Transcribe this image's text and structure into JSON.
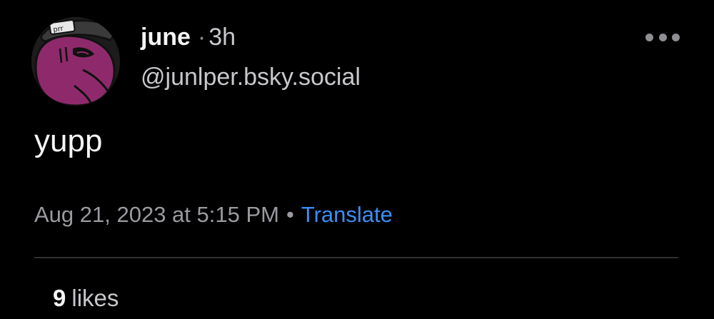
{
  "author": {
    "display_name": "june",
    "separator": "·",
    "age": "3h",
    "handle": "@junlper.bsky.social",
    "avatar_icon": "purple-character-avatar-icon",
    "avatar_hat_text": "prr"
  },
  "post": {
    "text": "yupp"
  },
  "meta": {
    "timestamp": "Aug 21, 2023 at 5:15 PM",
    "dot": "•",
    "translate_label": "Translate"
  },
  "stats": {
    "likes_count": "9",
    "likes_label": "likes"
  },
  "menu": {
    "icon": "more-horizontal-icon"
  },
  "colors": {
    "background": "#000000",
    "link": "#3b8ef5",
    "avatar_face": "#8e2a6b",
    "muted_text": "#9a9aa0"
  }
}
